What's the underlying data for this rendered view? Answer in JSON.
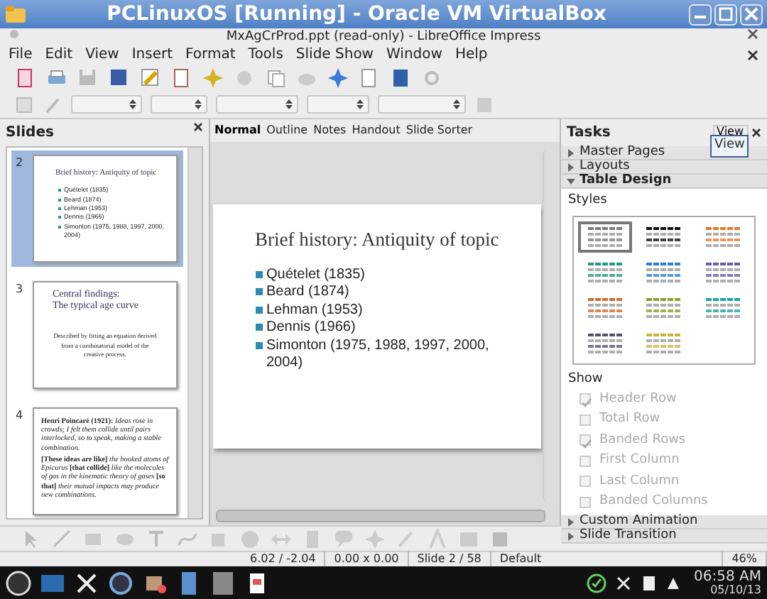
{
  "window": {
    "title": "PCLinuxOS [Running] - Oracle VM VirtualBox"
  },
  "document_title": "MxAgCrProd.ppt (read-only) - LibreOffice Impress",
  "menu": [
    "File",
    "Edit",
    "View",
    "Insert",
    "Format",
    "Tools",
    "Slide Show",
    "Window",
    "Help"
  ],
  "slides_panel": {
    "title": "Slides",
    "slides": [
      {
        "number": "2",
        "kind": "bullets",
        "selected": true,
        "title": "Brief history: Antiquity of topic",
        "bullets": [
          "Quételet (1835)",
          "Beard (1874)",
          "Lehman (1953)",
          "Dennis (1966)",
          "Simonton (1975, 1988, 1997, 2000, 2004)"
        ]
      },
      {
        "number": "3",
        "kind": "text",
        "selected": false,
        "title_lines": [
          "Central findings:",
          "The typical age curve"
        ],
        "body": "Described by fitting an equation derived from a combinatorial model of the creative process."
      },
      {
        "number": "4",
        "kind": "quote",
        "selected": false,
        "paragraphs": [
          "**Henri Poincaré (1921):** *Ideas rose in crowds; I felt them collide until pairs interlocked, so to speak, making a stable combination.*",
          "**[These ideas are like]** *the hooked atoms of Epicurus* **[that collide]** *like the molecules of gas in the kinematic theory of gases* **[so that]** *their mutual impacts may produce new combinations.*"
        ]
      }
    ]
  },
  "view_tabs": [
    {
      "label": "Normal",
      "selected": true
    },
    {
      "label": "Outline",
      "selected": false
    },
    {
      "label": "Notes",
      "selected": false
    },
    {
      "label": "Handout",
      "selected": false
    },
    {
      "label": "Slide Sorter",
      "selected": false
    }
  ],
  "slide": {
    "title": "Brief history: Antiquity of topic",
    "bullets": [
      "Quételet (1835)",
      "Beard (1874)",
      "Lehman (1953)",
      "Dennis (1966)",
      "Simonton (1975, 1988, 1997, 2000, 2004)"
    ]
  },
  "tasks": {
    "title": "Tasks",
    "view_menu": "View",
    "tooltip": "View",
    "sections": [
      {
        "label": "Master Pages",
        "expanded": false
      },
      {
        "label": "Layouts",
        "expanded": false
      },
      {
        "label": "Table Design",
        "expanded": true
      },
      {
        "label": "Custom Animation",
        "expanded": false
      },
      {
        "label": "Slide Transition",
        "expanded": false
      }
    ],
    "styles_label": "Styles",
    "table_styles": [
      {
        "color": "#7a7a7a",
        "selected": true
      },
      {
        "color": "#111111",
        "selected": false
      },
      {
        "color": "#e8782a",
        "selected": false
      },
      {
        "color": "#1f9c7c",
        "selected": false
      },
      {
        "color": "#2a7fd4",
        "selected": false
      },
      {
        "color": "#6c5aa8",
        "selected": false
      },
      {
        "color": "#d4682a",
        "selected": false
      },
      {
        "color": "#8aa02a",
        "selected": false
      },
      {
        "color": "#1ea3a3",
        "selected": false
      },
      {
        "color": "#55556a",
        "selected": false
      },
      {
        "color": "#c9b43a",
        "selected": false
      }
    ],
    "show_label": "Show",
    "options": [
      {
        "label": "Header Row",
        "checked": true,
        "disabled": true
      },
      {
        "label": "Total Row",
        "checked": false,
        "disabled": true
      },
      {
        "label": "Banded Rows",
        "checked": true,
        "disabled": true
      },
      {
        "label": "First Column",
        "checked": false,
        "disabled": true
      },
      {
        "label": "Last Column",
        "checked": false,
        "disabled": true
      },
      {
        "label": "Banded Columns",
        "checked": false,
        "disabled": true
      }
    ]
  },
  "status_bar": {
    "position": "6.02 / -2.04",
    "size": "0.00 x 0.00",
    "slide": "Slide 2 / 58",
    "layout": "Default",
    "zoom": "46%"
  },
  "taskbar": {
    "time": "06:58 AM",
    "date": "05/10/13"
  }
}
